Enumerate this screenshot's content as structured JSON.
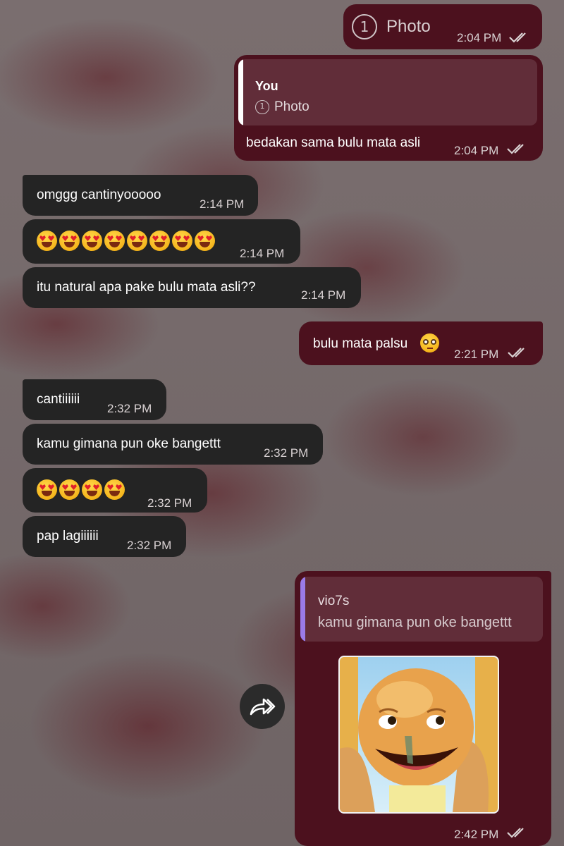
{
  "colors": {
    "incoming_bubble": "#242424",
    "outgoing_bubble": "#4c111e",
    "reply_bar_self": "#ffffff",
    "reply_bar_other": "#9a7be8",
    "time_text": "#d9d2d3"
  },
  "messages": [
    {
      "dir": "out",
      "kind": "photo-ref",
      "label": "Photo",
      "time": "2:04 PM",
      "status_icon": "double-check-icon"
    },
    {
      "dir": "out",
      "kind": "reply",
      "reply_author": "You",
      "reply_text": "Photo",
      "text": "bedakan sama bulu mata asli",
      "time": "2:04 PM",
      "status_icon": "double-check-icon"
    },
    {
      "dir": "in",
      "text": "omggg cantinyooooo",
      "time": "2:14 PM"
    },
    {
      "dir": "in",
      "kind": "emoji",
      "emoji_name": "heart-eyes-emoji",
      "emoji_count": 8,
      "time": "2:14 PM"
    },
    {
      "dir": "in",
      "text": "itu natural apa pake bulu mata asli??",
      "time": "2:14 PM"
    },
    {
      "dir": "out",
      "text": "bulu mata palsu",
      "trailing_emoji": "flushed-emoji",
      "time": "2:21 PM",
      "status_icon": "double-check-icon"
    },
    {
      "dir": "in",
      "text": "cantiiiiii",
      "time": "2:32 PM"
    },
    {
      "dir": "in",
      "text": "kamu gimana pun oke bangettt",
      "time": "2:32 PM"
    },
    {
      "dir": "in",
      "kind": "emoji",
      "emoji_name": "heart-eyes-emoji",
      "emoji_count": 4,
      "time": "2:32 PM"
    },
    {
      "dir": "in",
      "text": "pap lagiiiiii",
      "time": "2:32 PM"
    },
    {
      "dir": "out",
      "kind": "reply-sticker",
      "reply_author": "vio7s",
      "reply_text": "kamu gimana pun oke bangettt",
      "sticker_name": "cartoon-bald-kid-sticker",
      "time": "2:42 PM",
      "status_icon": "double-check-icon"
    }
  ],
  "forward_button": {
    "icon": "forward-arrow-icon"
  }
}
